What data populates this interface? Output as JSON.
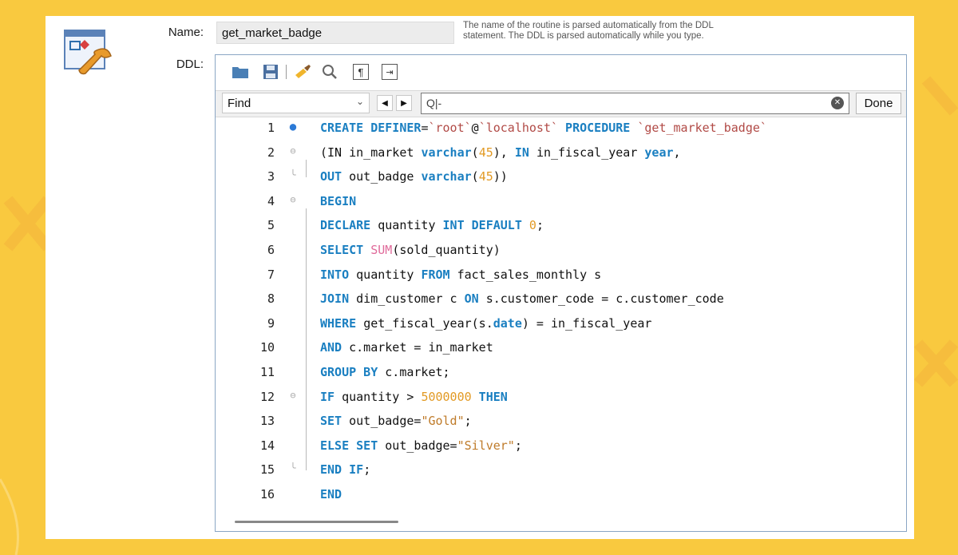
{
  "form": {
    "name_label": "Name:",
    "name_value": "get_market_badge",
    "ddl_label": "DDL:",
    "hint_line1": "The name of the routine is parsed automatically from the DDL",
    "hint_line2": "statement. The DDL is parsed automatically while you type."
  },
  "toolbar": {
    "icons": [
      "folder-icon",
      "save-icon",
      "beautify-icon",
      "search-icon",
      "paragraph-icon",
      "wrap-icon"
    ]
  },
  "find": {
    "mode": "Find",
    "input_prefix": "Q|-",
    "done_label": "Done"
  },
  "code": {
    "lines": [
      {
        "n": "1",
        "tokens": [
          [
            "kw",
            "CREATE DEFINER"
          ],
          [
            "",
            "="
          ],
          [
            "bt",
            "`root`"
          ],
          [
            "",
            "@"
          ],
          [
            "bt",
            "`localhost`"
          ],
          [
            "",
            ""
          ],
          [
            "kw",
            " PROCEDURE "
          ],
          [
            "bt",
            "`get_market_badge`"
          ]
        ]
      },
      {
        "n": "2",
        "tokens": [
          [
            "",
            "(IN "
          ],
          [
            "",
            "in_market "
          ],
          [
            "kw",
            "varchar"
          ],
          [
            "",
            "("
          ],
          [
            "num",
            "45"
          ],
          [
            "",
            "), "
          ],
          [
            "kw",
            "IN "
          ],
          [
            "",
            "in_fiscal_year "
          ],
          [
            "kw",
            "year"
          ],
          [
            "",
            ","
          ]
        ]
      },
      {
        "n": "3",
        "tokens": [
          [
            "kw",
            "OUT "
          ],
          [
            "",
            "out_badge "
          ],
          [
            "kw",
            "varchar"
          ],
          [
            "",
            "("
          ],
          [
            "num",
            "45"
          ],
          [
            "",
            "))"
          ]
        ]
      },
      {
        "n": "4",
        "tokens": [
          [
            "kw",
            "BEGIN"
          ]
        ]
      },
      {
        "n": "5",
        "tokens": [
          [
            "kw",
            "DECLARE "
          ],
          [
            "",
            "quantity "
          ],
          [
            "kw",
            "INT DEFAULT "
          ],
          [
            "num",
            "0"
          ],
          [
            "",
            ";"
          ]
        ]
      },
      {
        "n": "6",
        "tokens": [
          [
            "kw",
            "SELECT "
          ],
          [
            "fn",
            "SUM"
          ],
          [
            "",
            "(sold_quantity)"
          ]
        ]
      },
      {
        "n": "7",
        "tokens": [
          [
            "kw",
            "INTO "
          ],
          [
            "",
            "quantity "
          ],
          [
            "kw",
            "FROM "
          ],
          [
            "",
            "fact_sales_monthly s"
          ]
        ]
      },
      {
        "n": "8",
        "tokens": [
          [
            "kw",
            "JOIN "
          ],
          [
            "",
            "dim_customer c "
          ],
          [
            "kw",
            "ON "
          ],
          [
            "",
            "s.customer_code = c.customer_code"
          ]
        ]
      },
      {
        "n": "9",
        "tokens": [
          [
            "kw",
            "WHERE "
          ],
          [
            "",
            "get_fiscal_year(s."
          ],
          [
            "kw",
            "date"
          ],
          [
            "",
            ") = in_fiscal_year"
          ]
        ]
      },
      {
        "n": "10",
        "tokens": [
          [
            "kw",
            "AND "
          ],
          [
            "",
            "c.market = in_market"
          ]
        ]
      },
      {
        "n": "11",
        "tokens": [
          [
            "kw",
            "GROUP BY "
          ],
          [
            "",
            "c.market;"
          ]
        ]
      },
      {
        "n": "12",
        "tokens": [
          [
            "kw",
            "IF "
          ],
          [
            "",
            "quantity > "
          ],
          [
            "num",
            "5000000"
          ],
          [
            "kw",
            " THEN"
          ]
        ]
      },
      {
        "n": "13",
        "tokens": [
          [
            "kw",
            "SET "
          ],
          [
            "",
            "out_badge="
          ],
          [
            "str",
            "\"Gold\""
          ],
          [
            "",
            ";"
          ]
        ]
      },
      {
        "n": "14",
        "tokens": [
          [
            "kw",
            "ELSE SET "
          ],
          [
            "",
            "out_badge="
          ],
          [
            "str",
            "\"Silver\""
          ],
          [
            "",
            ";"
          ]
        ]
      },
      {
        "n": "15",
        "tokens": [
          [
            "kw",
            "END IF"
          ],
          [
            "",
            ";"
          ]
        ]
      },
      {
        "n": "16",
        "tokens": [
          [
            "kw",
            "END"
          ]
        ]
      }
    ],
    "markers": {
      "1": "dot",
      "2": "fold",
      "3": "foldend",
      "4": "fold",
      "12": "fold",
      "15": "foldend"
    }
  }
}
